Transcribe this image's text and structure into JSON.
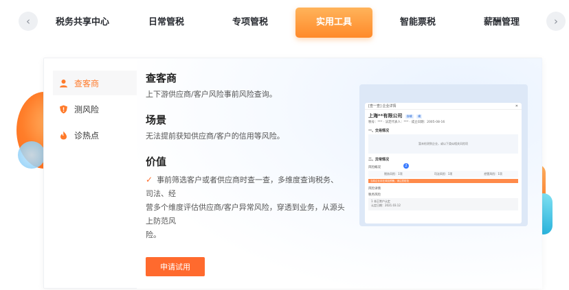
{
  "nav": {
    "tabs": [
      {
        "label": "税务共享中心"
      },
      {
        "label": "日常管税"
      },
      {
        "label": "专项管税"
      },
      {
        "label": "实用工具"
      },
      {
        "label": "智能票税"
      },
      {
        "label": "薪酬管理"
      }
    ],
    "active_tab": "实用工具",
    "prev_icon": "chevron-left-icon",
    "next_icon": "chevron-right-icon"
  },
  "side_menu": {
    "items": [
      {
        "label": "查客商",
        "icon": "user-icon"
      },
      {
        "label": "测风险",
        "icon": "shield-icon"
      },
      {
        "label": "诊热点",
        "icon": "flame-icon"
      }
    ],
    "active_index": 0
  },
  "content": {
    "title": "查客商",
    "description": "上下游供应商/客户风险事前风险查询。",
    "scene_title": "场景",
    "scene_desc": "无法提前获知供应商/客户的信用等风险。",
    "value_title": "价值",
    "value_lines": [
      "事前筛选客户或者供应商时查一查，多维度查询税务、司法、经",
      "营多个维度评估供应商/客户异常风险，穿透到业务，从源头上防范风",
      "险。"
    ]
  },
  "apply_button": "申请试用",
  "preview": {
    "header": "[查一查] 企业详情",
    "company": "上海**有限公司",
    "tags": [
      "存续",
      "续"
    ],
    "info": "税号：*** · 法定代表人：*** · 成立日期：2005-08-16",
    "section1": "一、交易情况",
    "box_text": "暂未检测到企业，或以下类似相关风险项",
    "section2": "二、异常情况",
    "badge": "2",
    "risk_overview": "风险概况",
    "row_items": [
      "税务风险：1项",
      "司法风险：1项",
      "经营风险：1项"
    ],
    "warn_text": "当前企业存在风险预警，请注意防范",
    "sub_title": "风险详情",
    "tax_risk": "税务风险",
    "card_lines": [
      "1 非正常户认定",
      "认定日期：2021.03.12"
    ]
  },
  "colors": {
    "accent": "#ff7a2a",
    "tab_active_start": "#ffb35a",
    "tab_active_end": "#ff8a2a",
    "button": "#ff6a2e"
  }
}
